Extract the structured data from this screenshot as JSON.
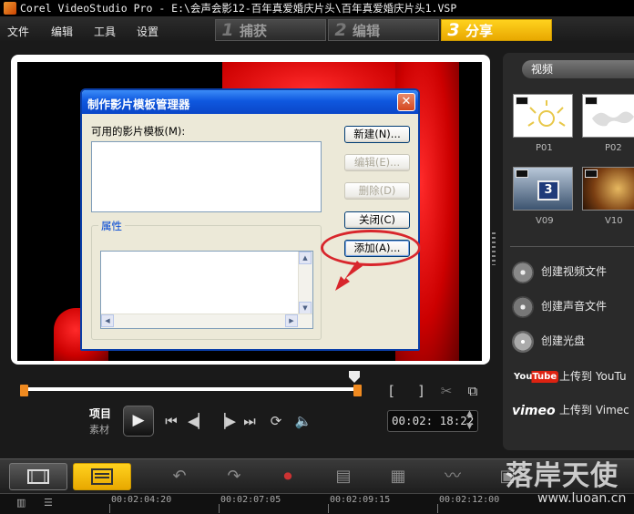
{
  "window": {
    "title": "Corel VideoStudio Pro - E:\\会声会影12-百年真爱婚庆片头\\百年真爱婚庆片头1.VSP"
  },
  "menu": [
    "文件",
    "编辑",
    "工具",
    "设置"
  ],
  "steps": [
    {
      "num": "1",
      "label": "捕获",
      "active": false
    },
    {
      "num": "2",
      "label": "编辑",
      "active": false
    },
    {
      "num": "3",
      "label": "分享",
      "active": true
    }
  ],
  "dialog": {
    "title": "制作影片模板管理器",
    "close": "✕",
    "templates_label": "可用的影片模板(M):",
    "properties_label": "属性",
    "buttons": {
      "new": "新建(N)...",
      "edit": "编辑(E)...",
      "delete": "删除(D)",
      "close": "关闭(C)",
      "add": "添加(A)..."
    }
  },
  "controls": {
    "project_label": "项目",
    "clip_label": "素材",
    "play": "▶",
    "timecode": "00:02: 18:22",
    "mark_in": "[",
    "mark_out": "]"
  },
  "library": {
    "category": "视频",
    "thumbnails": [
      {
        "label": "P01"
      },
      {
        "label": "P02"
      },
      {
        "label": "V09",
        "badge": "3"
      },
      {
        "label": "V10"
      }
    ]
  },
  "share": [
    {
      "icon": "film-reel-icon",
      "label": "创建视频文件"
    },
    {
      "icon": "audio-disc-icon",
      "label": "创建声音文件"
    },
    {
      "icon": "disc-icon",
      "label": "创建光盘"
    },
    {
      "brand": "YouTube",
      "label": "上传到 YouTu"
    },
    {
      "brand": "vimeo",
      "label": "上传到 Vimec"
    }
  ],
  "timeline": {
    "ticks": [
      "00:02:04:20",
      "00:02:07:05",
      "00:02:09:15",
      "00:02:12:00"
    ]
  },
  "watermark": {
    "text": "落岸天使",
    "url": "www.luoan.cn"
  },
  "colors": {
    "accent": "#f5c010",
    "dialog_title": "#0f58df",
    "annotation": "#d8262c"
  }
}
